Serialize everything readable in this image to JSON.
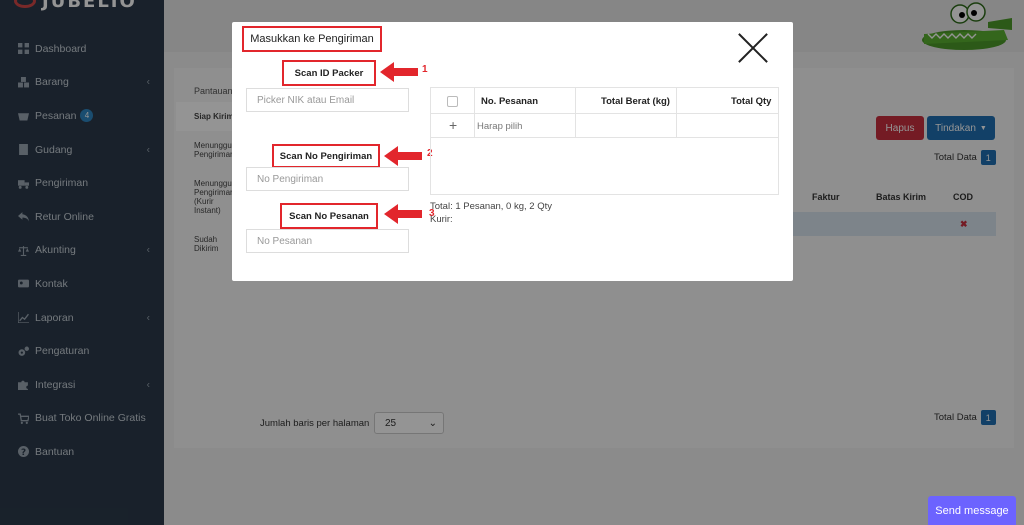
{
  "sidebar": {
    "brand": "JUBELIO",
    "items": [
      {
        "label": "Dashboard",
        "icon": "dashboard-icon",
        "chevron": false
      },
      {
        "label": "Barang",
        "icon": "cubes-icon",
        "chevron": true
      },
      {
        "label": "Pesanan",
        "icon": "basket-icon",
        "chevron": false,
        "badge": "4"
      },
      {
        "label": "Gudang",
        "icon": "building-icon",
        "chevron": true
      },
      {
        "label": "Pengiriman",
        "icon": "truck-icon",
        "chevron": false
      },
      {
        "label": "Retur Online",
        "icon": "reply-icon",
        "chevron": false
      },
      {
        "label": "Akunting",
        "icon": "balance-icon",
        "chevron": true
      },
      {
        "label": "Kontak",
        "icon": "contact-card-icon",
        "chevron": false
      },
      {
        "label": "Laporan",
        "icon": "chart-icon",
        "chevron": true
      },
      {
        "label": "Pengaturan",
        "icon": "gears-icon",
        "chevron": false
      },
      {
        "label": "Integrasi",
        "icon": "puzzle-icon",
        "chevron": true
      },
      {
        "label": "Buat Toko Online Gratis",
        "icon": "cart-icon",
        "chevron": false
      },
      {
        "label": "Bantuan",
        "icon": "question-icon",
        "chevron": false
      }
    ]
  },
  "background": {
    "tab_heading": "Pantauan",
    "tabs": [
      "Siap Kirim",
      "Menunggu Pengiriman",
      "Menunggu Pengiriman (Kurir Instant)",
      "Sudah Dikirim"
    ],
    "hapus": "Hapus",
    "tindakan": "Tindakan",
    "total_data_label": "Total Data",
    "total_data_value": "1",
    "columns": [
      "Faktur",
      "Batas Kirim",
      "COD"
    ],
    "cod_mark": "✖",
    "rows_per_page_label": "Jumlah baris per halaman",
    "rows_per_page_value": "25"
  },
  "modal": {
    "title": "Masukkan ke Pengiriman",
    "scan_id_packer": "Scan ID Packer",
    "scan_id_packer_placeholder": "Picker NIK atau Email",
    "scan_no_pengiriman": "Scan No Pengiriman",
    "scan_no_pengiriman_placeholder": "No Pengiriman",
    "scan_no_pesanan": "Scan No Pesanan",
    "scan_no_pesanan_placeholder": "No Pesanan",
    "annotations": [
      "1",
      "2",
      "3"
    ],
    "table": {
      "headers": [
        "No. Pesanan",
        "Total Berat (kg)",
        "Total Qty"
      ],
      "placeholder_row": "Harap pilih"
    },
    "summary_total": "Total: 1 Pesanan, 0 kg, 2 Qty",
    "summary_kurir": "Kurir:"
  },
  "send_message": "Send message"
}
